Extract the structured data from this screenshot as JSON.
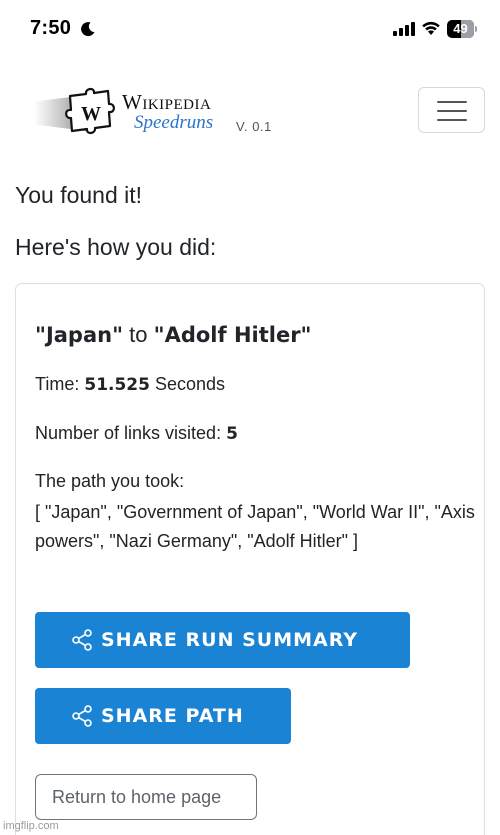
{
  "status_bar": {
    "time": "7:50",
    "battery": "49"
  },
  "header": {
    "brand_title": "Wikipedia",
    "brand_subtitle": "Speedruns",
    "version": "V. 0.1"
  },
  "result": {
    "heading": "You found it!",
    "subheading": "Here's how you did:",
    "start_article": "\"Japan\"",
    "route_connector": "to",
    "end_article": "\"Adolf Hitler\"",
    "time_label": "Time:",
    "time_value": "51.525",
    "time_unit": "Seconds",
    "links_label": "Number of links visited:",
    "links_value": "5",
    "path_label": "The path you took:",
    "path_text": "[ \"Japan\", \"Government of Japan\", \"World War II\", \"Axis powers\", \"Nazi Germany\", \"Adolf Hitler\" ]"
  },
  "actions": {
    "share_summary_label": "SHARE RUN SUMMARY",
    "share_path_label": "SHARE PATH",
    "home_label": "Return to home page"
  },
  "watermark": "imgflip.com",
  "colors": {
    "primary": "#1a83d4",
    "speedruns_blue": "#2a73cc",
    "text": "#212529"
  }
}
